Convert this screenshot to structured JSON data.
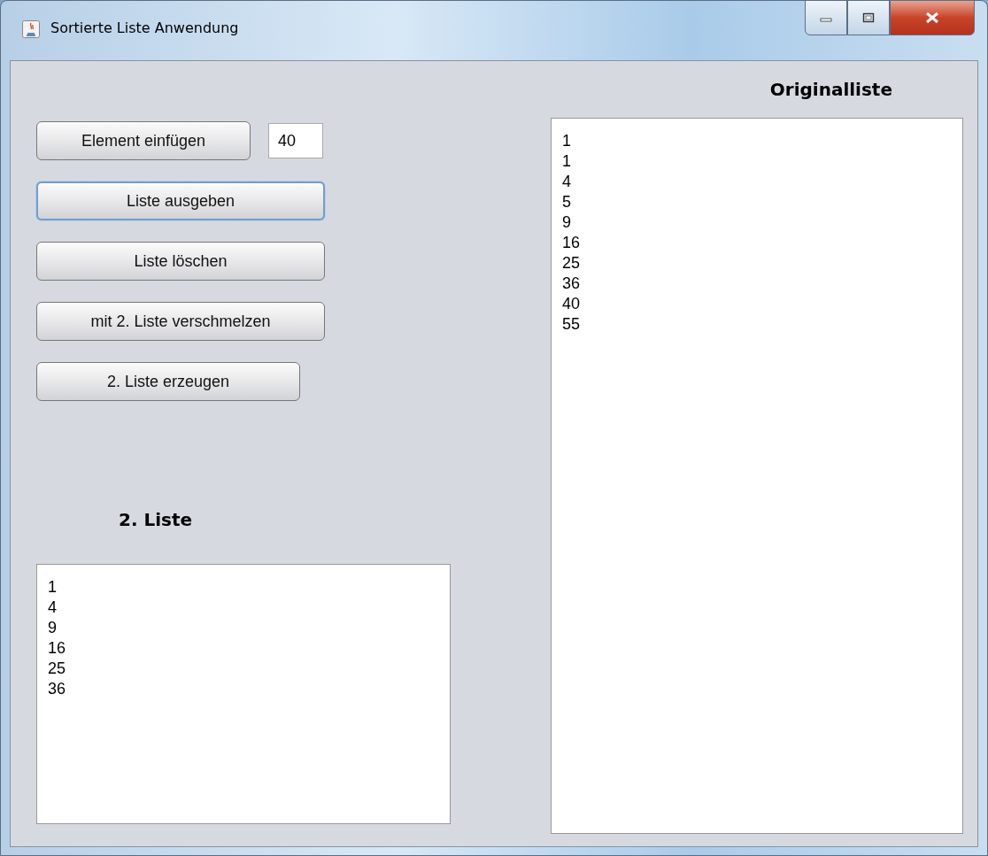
{
  "window": {
    "title": "Sortierte Liste Anwendung"
  },
  "buttons": [
    {
      "label": "Element einfügen",
      "focused": false,
      "kind": "with-field"
    },
    {
      "label": "Liste ausgeben",
      "focused": true,
      "kind": "wide"
    },
    {
      "label": "Liste löschen",
      "focused": false,
      "kind": "wide"
    },
    {
      "label": "mit 2. Liste verschmelzen",
      "focused": false,
      "kind": "wide"
    },
    {
      "label": "2. Liste erzeugen",
      "focused": false,
      "kind": "short"
    }
  ],
  "input": {
    "value": "40"
  },
  "second_list": {
    "title": "2. Liste",
    "items": [
      "1",
      "4",
      "9",
      "16",
      "25",
      "36"
    ]
  },
  "original_list": {
    "title": "Originalliste",
    "items": [
      "1",
      "1",
      "4",
      "5",
      "9",
      "16",
      "25",
      "36",
      "40",
      "55"
    ]
  }
}
